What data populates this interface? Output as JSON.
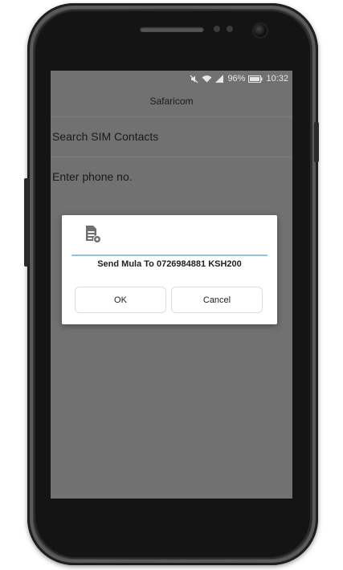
{
  "status_bar": {
    "battery_percent": "96%",
    "time": "10:32",
    "icons": [
      "mute-icon",
      "wifi-icon",
      "signal-icon",
      "battery-icon"
    ]
  },
  "screen": {
    "title": "Safaricom",
    "items": [
      {
        "label": "Search SIM Contacts"
      },
      {
        "label": "Enter phone no."
      }
    ]
  },
  "dialog": {
    "icon": "sim-card-settings-icon",
    "message": "Send Mula To 0726984881 KSH200",
    "ok_label": "OK",
    "cancel_label": "Cancel"
  },
  "colors": {
    "screen_dim": "#717171",
    "dialog_bg": "#ffffff",
    "divider": "#8fc7d8"
  }
}
